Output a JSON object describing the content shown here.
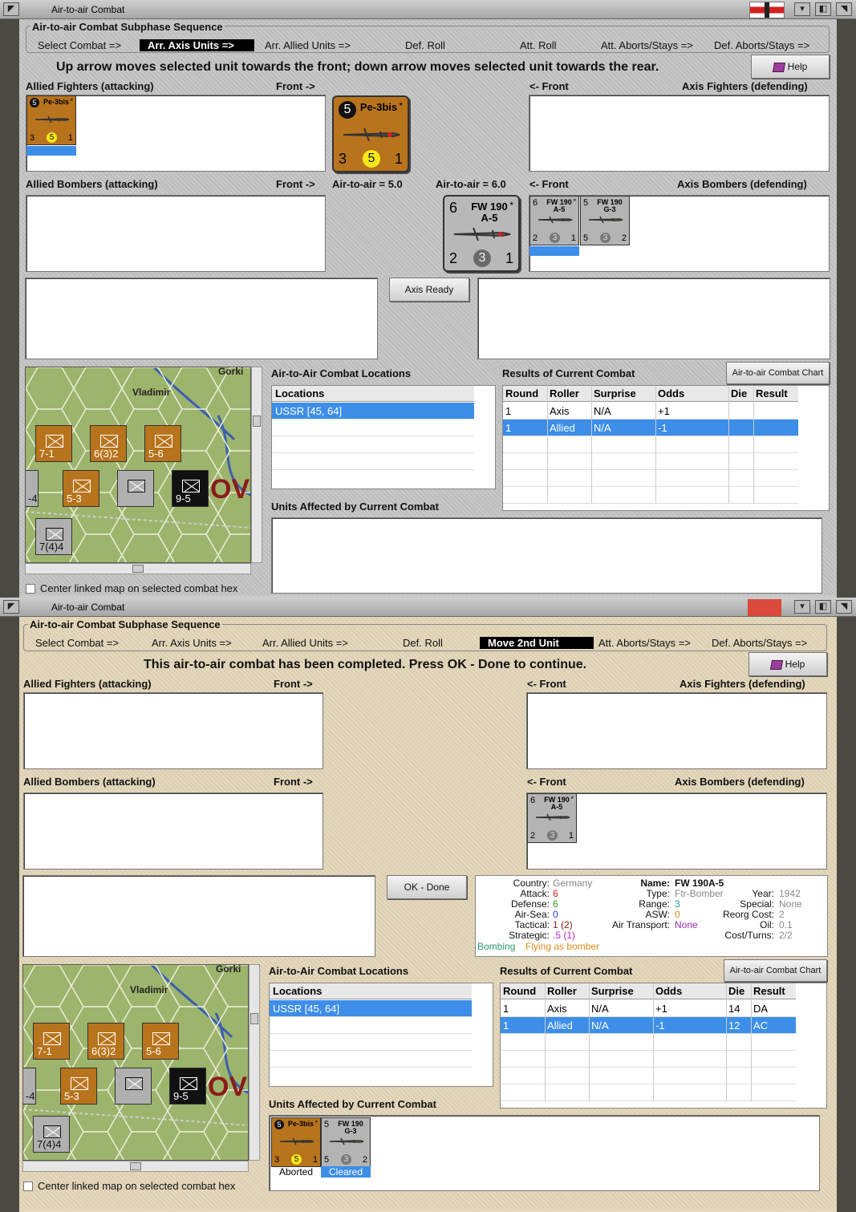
{
  "w1": {
    "title": "Air-to-air Combat",
    "sequence": {
      "title": "Air-to-air Combat Subphase Sequence",
      "steps": [
        "Select Combat =>",
        "Arr. Axis Units =>",
        "Arr. Allied Units =>",
        "Def. Roll",
        "Att. Roll",
        "Att. Aborts/Stays =>",
        "Def. Aborts/Stays =>"
      ],
      "active_index": 1
    },
    "instruction": "Up arrow moves selected unit towards the front; down arrow moves selected unit towards the rear.",
    "help_label": "Help",
    "allied_fighters_label": "Allied Fighters (attacking)",
    "front_right": "Front ->",
    "front_left": "<- Front",
    "axis_fighters_label": "Axis Fighters (defending)",
    "allied_bombers_label": "Allied Bombers (attacking)",
    "axis_bombers_label": "Axis Bombers (defending)",
    "air_to_air_attacker": "Air-to-air = 5.0",
    "air_to_air_defender": "Air-to-air = 6.0",
    "ready_button": "Axis Ready",
    "locations_title": "Air-to-Air Combat Locations",
    "results_title": "Results of Current Combat",
    "chart_button": "Air-to-air Combat Chart",
    "units_affected_title": "Units Affected by Current Combat",
    "center_map_label": "Center linked map on selected combat hex",
    "locations_header": "Locations",
    "locations": [
      "USSR [45, 64]"
    ],
    "results_headers": [
      "Round",
      "Roller",
      "Surprise",
      "Odds",
      "Die",
      "Result"
    ],
    "results_rows": [
      [
        "1",
        "Axis",
        "N/A",
        "+1",
        "",
        ""
      ],
      [
        "1",
        "Allied",
        "N/A",
        "-1",
        "",
        ""
      ]
    ],
    "big_attacker": {
      "attack": "5",
      "name": "Pe-3bis",
      "star": "*",
      "left": "3",
      "mid": "5",
      "right": "1"
    },
    "big_defender": {
      "attack": "6",
      "name": "FW 190\nA-5",
      "star": "*",
      "left": "2",
      "mid": "3",
      "right": "1"
    }
  },
  "w2": {
    "title": "Air-to-air Combat",
    "sequence": {
      "title": "Air-to-air Combat Subphase Sequence",
      "steps": [
        "Select Combat =>",
        "Arr. Axis Units =>",
        "Arr. Allied Units =>",
        "Def. Roll",
        "Move 2nd Unit",
        "Att. Aborts/Stays =>",
        "Def. Aborts/Stays =>"
      ],
      "active_index": 4
    },
    "instruction": "This air-to-air combat has been completed.  Press OK - Done to continue.",
    "help_label": "Help",
    "allied_fighters_label": "Allied Fighters (attacking)",
    "front_right": "Front ->",
    "front_left": "<- Front",
    "axis_fighters_label": "Axis Fighters (defending)",
    "allied_bombers_label": "Allied Bombers (attacking)",
    "axis_bombers_label": "Axis Bombers (defending)",
    "ok_button": "OK - Done",
    "locations_title": "Air-to-Air Combat Locations",
    "results_title": "Results of Current Combat",
    "chart_button": "Air-to-air Combat Chart",
    "units_affected_title": "Units Affected by Current Combat",
    "center_map_label": "Center linked map on selected combat hex",
    "locations_header": "Locations",
    "locations": [
      "USSR [45, 64]"
    ],
    "results_headers": [
      "Round",
      "Roller",
      "Surprise",
      "Odds",
      "Die",
      "Result"
    ],
    "results_rows": [
      [
        "1",
        "Axis",
        "N/A",
        "+1",
        "14",
        "DA"
      ],
      [
        "1",
        "Allied",
        "N/A",
        "-1",
        "12",
        "AC"
      ]
    ],
    "affected": [
      {
        "status": "Aborted"
      },
      {
        "status": "Cleared"
      }
    ],
    "info": {
      "country_k": "Country:",
      "country_v": "Germany",
      "attack_k": "Attack:",
      "attack_v": "6",
      "defense_k": "Defense:",
      "defense_v": "6",
      "airsea_k": "Air-Sea:",
      "airsea_v": "0",
      "tactical_k": "Tactical:",
      "tactical_v": "1 (2)",
      "strategic_k": "Strategic:",
      "strategic_v": ".5 (1)",
      "bombing": "Bombing",
      "flying": "Flying as bomber",
      "name_k": "Name:",
      "name_v": "FW 190A-5",
      "type_k": "Type:",
      "type_v": "Ftr-Bomber",
      "range_k": "Range:",
      "range_v": "3",
      "asw_k": "ASW:",
      "asw_v": "0",
      "airtrans_k": "Air Transport:",
      "airtrans_v": "None",
      "year_k": "Year:",
      "year_v": "1942",
      "special_k": "Special:",
      "special_v": "None",
      "reorg_k": "Reorg Cost:",
      "reorg_v": "2",
      "oil_k": "Oil:",
      "oil_v": "0.1",
      "cost_k": "Cost/Turns:",
      "cost_v": "2/2"
    }
  },
  "counters": {
    "pe3": {
      "attack": "5",
      "name": "Pe-3bis",
      "star": "*",
      "left": "3",
      "mid": "5",
      "right": "1"
    },
    "fw190a5": {
      "attack": "6",
      "name": "FW 190\nA-5",
      "star": "*",
      "left": "2",
      "mid": "3",
      "right": "1"
    },
    "fw190g3": {
      "attack": "5",
      "name": "FW 190\nG-3",
      "star": "",
      "left": "5",
      "mid": "3",
      "right": "2"
    }
  },
  "map": {
    "town_1": "Gorki",
    "town_2": "Vladimir",
    "ov": "OV",
    "units": [
      {
        "str": "7-1"
      },
      {
        "str": "6(3)2"
      },
      {
        "str": "5-6"
      },
      {
        "str": "5-3"
      },
      {
        "str": "9-5"
      },
      {
        "str": "7(4)4"
      },
      {
        "str": "-4"
      }
    ]
  },
  "colors": {
    "selection": "#3d8ee8",
    "axis_panel": "#c4c4c4",
    "allied_panel": "#e2d5b7",
    "soviet_counter": "#b8741c",
    "german_counter": "#b4b4b4",
    "country_grey": "#888888",
    "attack_red": "#d02020",
    "defense_green": "#2a9a2a",
    "airsea_blue": "#2040d0",
    "range_teal": "#1a9aa0",
    "asw_orange": "#e08a1a",
    "airtrans_purple": "#9a2ab0",
    "tactical_brown": "#8a1a1a",
    "strategic_magenta": "#c020c0"
  }
}
